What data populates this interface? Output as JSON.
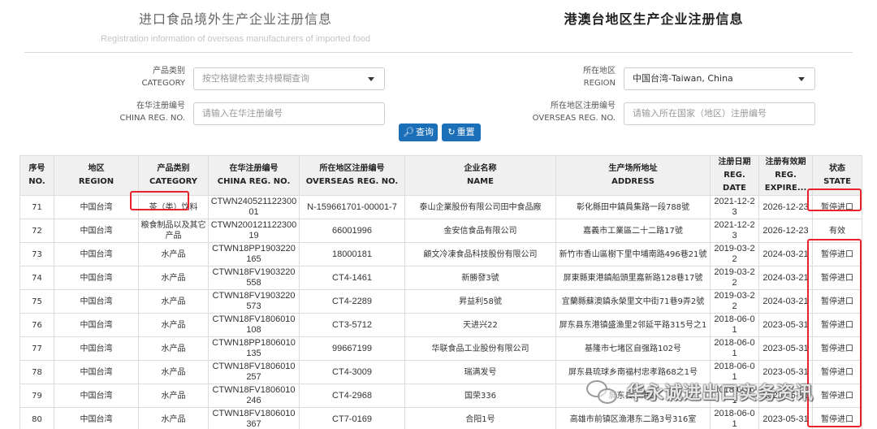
{
  "tabs": {
    "left": {
      "title": "进口食品境外生产企业注册信息",
      "subtitle": "Registration information of overseas manufacturers of imported food"
    },
    "right": {
      "title": "港澳台地区生产企业注册信息"
    }
  },
  "form": {
    "category": {
      "label_cn": "产品类别",
      "label_en": "CATEGORY",
      "placeholder": "按空格键检索支持模糊查询"
    },
    "region": {
      "label_cn": "所在地区",
      "label_en": "REGION",
      "value": "中国台湾-Taiwan, China"
    },
    "china_reg": {
      "label_cn": "在华注册编号",
      "label_en": "CHINA REG. NO.",
      "placeholder": "请输入在华注册编号"
    },
    "overseas_reg": {
      "label_cn": "所在地区注册编号",
      "label_en": "OVERSEAS REG. NO.",
      "placeholder": "请输入所在国家（地区）注册编号"
    }
  },
  "buttons": {
    "search": "查询",
    "reset": "重置"
  },
  "table": {
    "headers": [
      {
        "cn": "序号",
        "en": "NO."
      },
      {
        "cn": "地区",
        "en": "REGION"
      },
      {
        "cn": "产品类别",
        "en": "CATEGORY"
      },
      {
        "cn": "在华注册编号",
        "en": "CHINA REG. NO."
      },
      {
        "cn": "所在地区注册编号",
        "en": "OVERSEAS REG. NO."
      },
      {
        "cn": "企业名称",
        "en": "NAME"
      },
      {
        "cn": "生产场所地址",
        "en": "ADDRESS"
      },
      {
        "cn": "注册日期",
        "en": "REG. DATE"
      },
      {
        "cn": "注册有效期",
        "en": "REG. EXPIRE..."
      },
      {
        "cn": "状态",
        "en": "STATE"
      }
    ],
    "rows": [
      [
        "71",
        "中国台湾",
        "茶（类）饮料",
        "CTWN24052112230001",
        "N-159661701-00001-7",
        "泰山企業股份有限公司田中食品廠",
        "彰化縣田中鎮員集路一段788號",
        "2021-12-23",
        "2026-12-23",
        "暂停进口"
      ],
      [
        "72",
        "中国台湾",
        "粮食制品以及其它产品",
        "CTWN20012112230019",
        "66001996",
        "金安信食品有限公司",
        "嘉義市工業區二十二路17號",
        "2021-12-23",
        "2026-12-23",
        "有效"
      ],
      [
        "73",
        "中国台湾",
        "水产品",
        "CTWN18PP1903220165",
        "18000181",
        "顧文冷凍食品科技股份有限公司",
        "新竹市香山區樹下里中埔南路496巷21號",
        "2019-03-22",
        "2024-03-21",
        "暂停进口"
      ],
      [
        "74",
        "中国台湾",
        "水产品",
        "CTWN18FV1903220558",
        "CT4-1461",
        "新勝發3號",
        "屏東縣東港鎮船頭里嘉新路128巷17號",
        "2019-03-22",
        "2024-03-21",
        "暂停进口"
      ],
      [
        "75",
        "中国台湾",
        "水产品",
        "CTWN18FV1903220573",
        "CT4-2289",
        "昇益利58號",
        "宜蘭縣蘇澳鎮永榮里文中街71巷9弄2號",
        "2019-03-22",
        "2024-03-21",
        "暂停进口"
      ],
      [
        "76",
        "中国台湾",
        "水产品",
        "CTWN18FV1806010108",
        "CT3-5712",
        "天进兴22",
        "屏东县东港镇盛渔里2邻延平路315号之1",
        "2018-06-01",
        "2023-05-31",
        "暂停进口"
      ],
      [
        "77",
        "中国台湾",
        "水产品",
        "CTWN18PP1806010135",
        "99667199",
        "华联食品工业股份有限公司",
        "基隆市七堵区自强路102号",
        "2018-06-01",
        "2023-05-31",
        "暂停进口"
      ],
      [
        "78",
        "中国台湾",
        "水产品",
        "CTWN18FV1806010257",
        "CT4-3009",
        "瑞满发号",
        "屏东县琉球乡南福村忠孝路68之1号",
        "2018-06-01",
        "2023-05-31",
        "暂停进口"
      ],
      [
        "79",
        "中国台湾",
        "水产品",
        "CTWN18FV1806010246",
        "CT4-2968",
        "国荣336",
        "屏东县东港镇",
        "2018-06-01",
        "2023-05-31",
        "暂停进口"
      ],
      [
        "80",
        "中国台湾",
        "水产品",
        "CTWN18FV1806010367",
        "CT7-0169",
        "合阳1号",
        "高雄市前镇区渔港东二路3号316室",
        "2018-06-01",
        "2023-05-31",
        "暂停进口"
      ]
    ]
  },
  "watermark": {
    "text": "华永诚进出口实务资讯"
  },
  "colors": {
    "primary_button": "#1a6fb8",
    "highlight_box": "#e8232d",
    "header_bg": "#f0f0f0"
  }
}
